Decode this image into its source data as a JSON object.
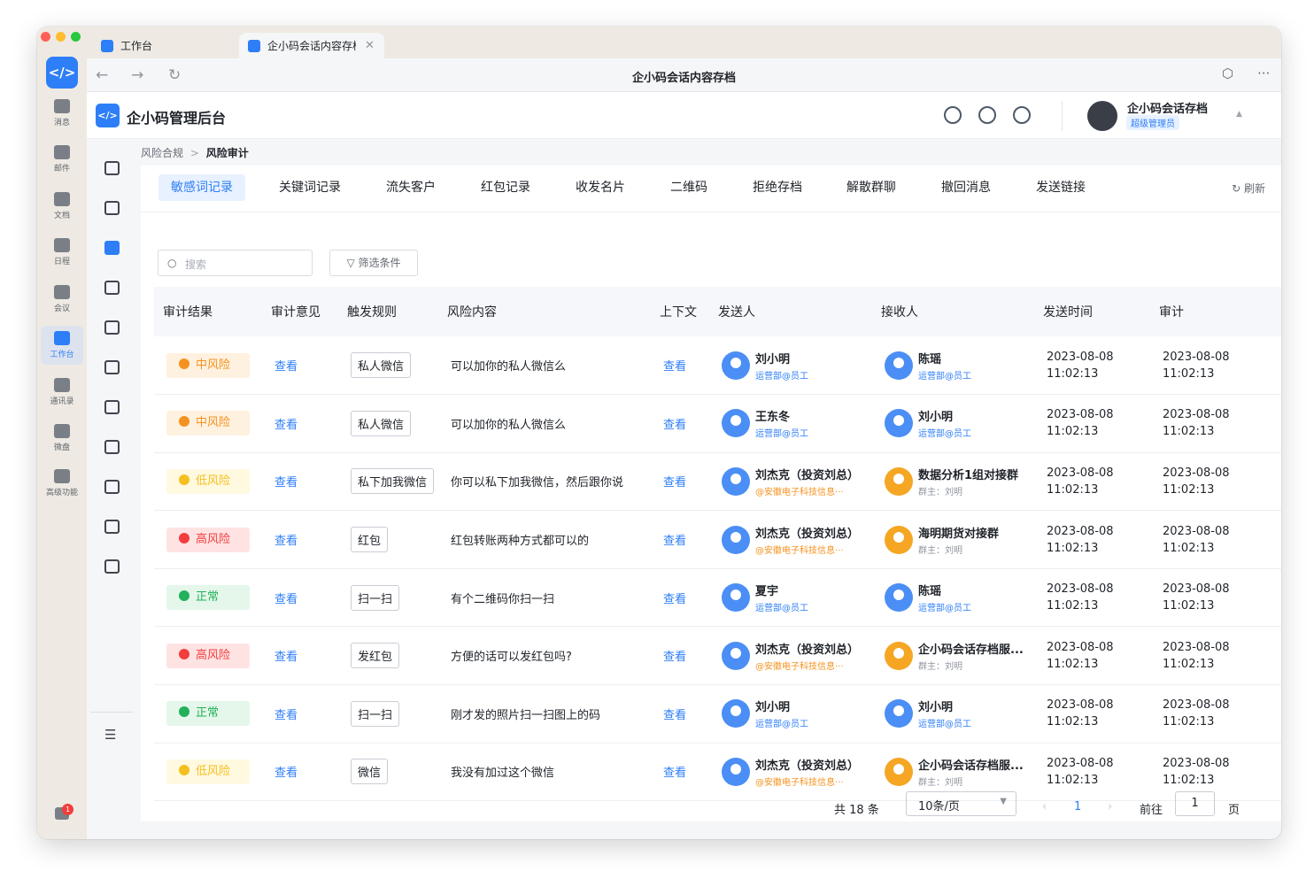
{
  "window": {
    "tabs": [
      {
        "label": "工作台"
      },
      {
        "label": "企小码会话内容存档"
      }
    ],
    "title": "企小码会话内容存档"
  },
  "rail": {
    "items": [
      {
        "label": "消息",
        "icon": "chat-bubble-icon"
      },
      {
        "label": "邮件",
        "icon": "mail-icon"
      },
      {
        "label": "文档",
        "icon": "doc-icon"
      },
      {
        "label": "日程",
        "icon": "calendar-icon"
      },
      {
        "label": "会议",
        "icon": "meeting-icon"
      },
      {
        "label": "工作台",
        "icon": "grid-icon"
      },
      {
        "label": "通讯录",
        "icon": "org-icon"
      },
      {
        "label": "微盘",
        "icon": "disk-icon"
      },
      {
        "label": "高级功能",
        "icon": "sparkle-icon"
      }
    ],
    "badge": "1"
  },
  "app": {
    "name": "企小码管理后台",
    "user_name": "企小码会话存档",
    "user_role": "超级管理员"
  },
  "breadcrumb": {
    "parent": "风险合规",
    "separator": ">",
    "current": "风险审计"
  },
  "content_tabs": [
    "敏感词记录",
    "关键词记录",
    "流失客户",
    "红包记录",
    "收发名片",
    "二维码",
    "拒绝存档",
    "解散群聊",
    "撤回消息",
    "发送链接"
  ],
  "refresh_label": "刷新",
  "search": {
    "placeholder": "搜索"
  },
  "filter_label": "筛选条件",
  "table": {
    "headers": [
      "审计结果",
      "审计意见",
      "触发规则",
      "风险内容",
      "上下文",
      "发送人",
      "接收人",
      "发送时间",
      "审计"
    ],
    "rows": [
      {
        "risk": "中风险",
        "level": "mid",
        "opinion": "查看",
        "rule": "私人微信",
        "content": "可以加你的私人微信么",
        "context": "查看",
        "sender": {
          "name": "刘小明",
          "sub": "运营部@员工",
          "type": "user"
        },
        "receiver": {
          "name": "陈瑶",
          "sub": "运营部@员工",
          "type": "user"
        },
        "send_date": "2023-08-08",
        "send_time": "11:02:13",
        "audit_date": "2023-08-08",
        "audit_time": "11:02:13"
      },
      {
        "risk": "中风险",
        "level": "mid",
        "opinion": "查看",
        "rule": "私人微信",
        "content": "可以加你的私人微信么",
        "context": "查看",
        "sender": {
          "name": "王东冬",
          "sub": "运营部@员工",
          "type": "user"
        },
        "receiver": {
          "name": "刘小明",
          "sub": "运营部@员工",
          "type": "user"
        },
        "send_date": "2023-08-08",
        "send_time": "11:02:13",
        "audit_date": "2023-08-08",
        "audit_time": "11:02:13"
      },
      {
        "risk": "低风险",
        "level": "low",
        "opinion": "查看",
        "rule": "私下加我微信",
        "content": "你可以私下加我微信，然后跟你说",
        "context": "查看",
        "sender": {
          "name": "刘杰克（投资刘总）",
          "sub": "@安徽电子科技信息···",
          "type": "ext"
        },
        "receiver": {
          "name": "数据分析1组对接群",
          "sub": "群主：刘明",
          "type": "group"
        },
        "send_date": "2023-08-08",
        "send_time": "11:02:13",
        "audit_date": "2023-08-08",
        "audit_time": "11:02:13"
      },
      {
        "risk": "高风险",
        "level": "high",
        "opinion": "查看",
        "rule": "红包",
        "content": "红包转账两种方式都可以的",
        "context": "查看",
        "sender": {
          "name": "刘杰克（投资刘总）",
          "sub": "@安徽电子科技信息···",
          "type": "ext"
        },
        "receiver": {
          "name": "海明期货对接群",
          "sub": "群主：刘明",
          "type": "group"
        },
        "send_date": "2023-08-08",
        "send_time": "11:02:13",
        "audit_date": "2023-08-08",
        "audit_time": "11:02:13"
      },
      {
        "risk": "正常",
        "level": "ok",
        "opinion": "查看",
        "rule": "扫一扫",
        "content": "有个二维码你扫一扫",
        "context": "查看",
        "sender": {
          "name": "夏宇",
          "sub": "运营部@员工",
          "type": "user"
        },
        "receiver": {
          "name": "陈瑶",
          "sub": "运营部@员工",
          "type": "user"
        },
        "send_date": "2023-08-08",
        "send_time": "11:02:13",
        "audit_date": "2023-08-08",
        "audit_time": "11:02:13"
      },
      {
        "risk": "高风险",
        "level": "high",
        "opinion": "查看",
        "rule": "发红包",
        "content": "方便的话可以发红包吗?",
        "context": "查看",
        "sender": {
          "name": "刘杰克（投资刘总）",
          "sub": "@安徽电子科技信息···",
          "type": "ext"
        },
        "receiver": {
          "name": "企小码会话存档服...",
          "sub": "群主：刘明",
          "type": "group"
        },
        "send_date": "2023-08-08",
        "send_time": "11:02:13",
        "audit_date": "2023-08-08",
        "audit_time": "11:02:13"
      },
      {
        "risk": "正常",
        "level": "ok",
        "opinion": "查看",
        "rule": "扫一扫",
        "content": "刚才发的照片扫一扫图上的码",
        "context": "查看",
        "sender": {
          "name": "刘小明",
          "sub": "运营部@员工",
          "type": "user"
        },
        "receiver": {
          "name": "刘小明",
          "sub": "运营部@员工",
          "type": "user"
        },
        "send_date": "2023-08-08",
        "send_time": "11:02:13",
        "audit_date": "2023-08-08",
        "audit_time": "11:02:13"
      },
      {
        "risk": "低风险",
        "level": "low",
        "opinion": "查看",
        "rule": "微信",
        "content": "我没有加过这个微信",
        "context": "查看",
        "sender": {
          "name": "刘杰克（投资刘总）",
          "sub": "@安徽电子科技信息···",
          "type": "ext"
        },
        "receiver": {
          "name": "企小码会话存档服...",
          "sub": "群主：刘明",
          "type": "group"
        },
        "send_date": "2023-08-08",
        "send_time": "11:02:13",
        "audit_date": "2023-08-08",
        "audit_time": "11:02:13"
      }
    ]
  },
  "pagination": {
    "total": "共 18 条",
    "page_size": "10条/页",
    "current_page": "1",
    "goto_label": "前往",
    "goto_value": "1",
    "page_unit": "页"
  },
  "colors": {
    "accent": "#2d7ef7",
    "mid": "#f5921f",
    "low": "#f5c01f",
    "high": "#f23d3d",
    "ok": "#23b05b"
  }
}
